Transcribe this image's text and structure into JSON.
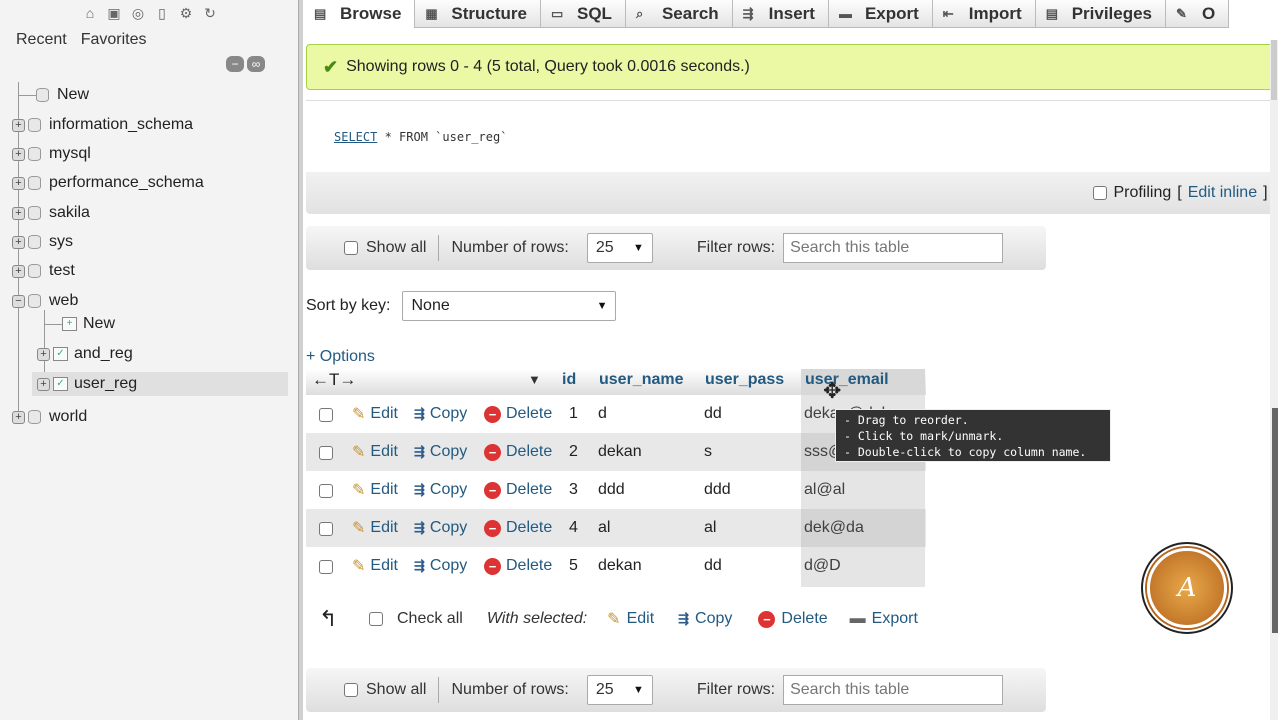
{
  "sidebar": {
    "recent_label": "Recent",
    "favorites_label": "Favorites",
    "new_label": "New",
    "databases": [
      "information_schema",
      "mysql",
      "performance_schema",
      "sakila",
      "sys",
      "test",
      "web"
    ],
    "web_children": {
      "new": "New",
      "tables": [
        "and_reg",
        "user_reg"
      ]
    },
    "last_db": "world"
  },
  "tabs": [
    "Browse",
    "Structure",
    "SQL",
    "Search",
    "Insert",
    "Export",
    "Import",
    "Privileges",
    "O"
  ],
  "message": {
    "text": "Showing rows 0 - 4 (5 total, Query took 0.0016 seconds.)"
  },
  "sql": {
    "keyword": "SELECT",
    "rest": "* FROM `user_reg`"
  },
  "profiling": {
    "label": "Profiling",
    "edit_inline": "Edit inline",
    "bracket_open": "[",
    "bracket_close": "]",
    "trailing": "["
  },
  "navbar": {
    "show_all": "Show all",
    "number_of_rows_label": "Number of rows:",
    "number_of_rows_value": "25",
    "filter_label": "Filter rows:",
    "filter_placeholder": "Search this table"
  },
  "sort": {
    "label": "Sort by key:",
    "value": "None"
  },
  "options_label": "+ Options",
  "columns": [
    "id",
    "user_name",
    "user_pass",
    "user_email"
  ],
  "actions": {
    "edit": "Edit",
    "copy": "Copy",
    "delete": "Delete"
  },
  "rows": [
    {
      "id": "1",
      "user_name": "d",
      "user_pass": "dd",
      "user_email": "dekan@dekan"
    },
    {
      "id": "2",
      "user_name": "dekan",
      "user_pass": "s",
      "user_email": "sss@"
    },
    {
      "id": "3",
      "user_name": "ddd",
      "user_pass": "ddd",
      "user_email": "al@al"
    },
    {
      "id": "4",
      "user_name": "al",
      "user_pass": "al",
      "user_email": "dek@da"
    },
    {
      "id": "5",
      "user_name": "dekan",
      "user_pass": "dd",
      "user_email": "d@D"
    }
  ],
  "tooltip": [
    "- Drag to reorder.",
    "- Click to mark/unmark.",
    "- Double-click to copy column name."
  ],
  "bulk": {
    "check_all": "Check all",
    "with_selected": "With selected:",
    "edit": "Edit",
    "copy": "Copy",
    "delete": "Delete",
    "export": "Export"
  }
}
